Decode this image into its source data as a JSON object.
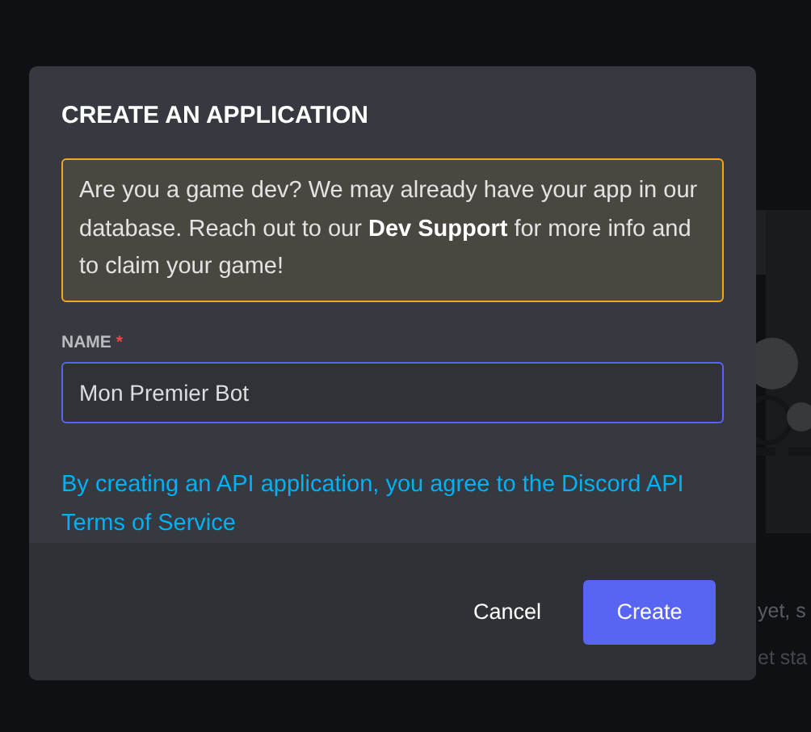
{
  "background": {
    "texts": [
      "yet, s",
      "et sta"
    ]
  },
  "modal": {
    "title": "CREATE AN APPLICATION",
    "notice": "Are you a game dev? We may already have your app in our database. Reach out to our **Dev Support** for more info and to claim your game!",
    "field": {
      "label": "NAME",
      "required": true,
      "required_mark": "*",
      "value": "Mon Premier Bot",
      "focused": true
    },
    "terms_link": "By creating an API application, you agree to the Discord API Terms of Service",
    "buttons": [
      {
        "label": "Cancel",
        "kind": "secondary"
      },
      {
        "label": "Create",
        "kind": "primary"
      }
    ]
  }
}
